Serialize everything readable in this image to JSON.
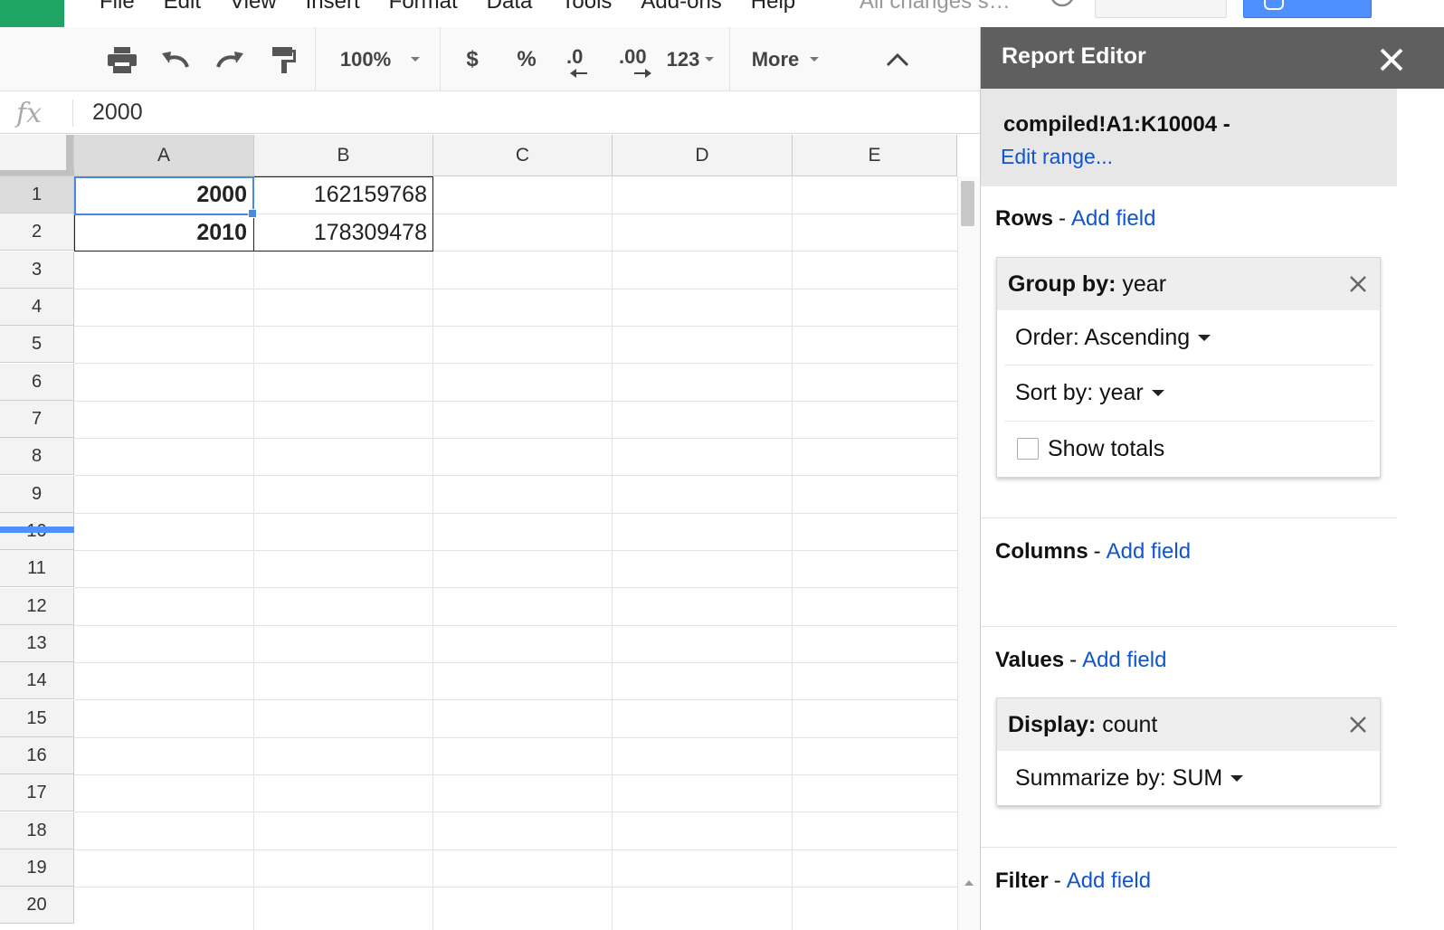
{
  "menu": {
    "items": [
      "File",
      "Edit",
      "View",
      "Insert",
      "Format",
      "Data",
      "Tools",
      "Add-ons",
      "Help"
    ],
    "save_status": "All changes s…"
  },
  "toolbar": {
    "zoom": "100%",
    "currency": "$",
    "percent": "%",
    "decrease_decimal": ".0",
    "increase_decimal": ".00",
    "number_format": "123",
    "more": "More"
  },
  "formula_bar": {
    "fx_label": "fx",
    "value": "2000"
  },
  "grid": {
    "columns": [
      "A",
      "B",
      "C",
      "D",
      "E"
    ],
    "rows": [
      "1",
      "2",
      "3",
      "4",
      "5",
      "6",
      "7",
      "8",
      "9",
      "10",
      "11",
      "12",
      "13",
      "14",
      "15",
      "16",
      "17",
      "18",
      "19",
      "20"
    ],
    "cells": {
      "A1": "2000",
      "B1": "162159768",
      "A2": "2010",
      "B2": "178309478"
    },
    "selected_cell": "A1"
  },
  "report_editor": {
    "title": "Report Editor",
    "range": "compiled!A1:K10004 -",
    "edit_range": "Edit range...",
    "rows": {
      "label": "Rows",
      "dash": "-",
      "add_field": "Add field",
      "card": {
        "head_key": "Group by:",
        "head_value": "year",
        "order": "Order: Ascending",
        "sort": "Sort by: year",
        "show_totals": "Show totals",
        "show_totals_checked": false
      }
    },
    "columns": {
      "label": "Columns",
      "dash": "-",
      "add_field": "Add field"
    },
    "values": {
      "label": "Values",
      "dash": "-",
      "add_field": "Add field",
      "card": {
        "head_key": "Display:",
        "head_value": "count",
        "summarize": "Summarize by: SUM"
      }
    },
    "filter": {
      "label": "Filter",
      "dash": "-",
      "add_field": "Add field"
    }
  },
  "colors": {
    "accent_blue": "#4a89dc",
    "link_blue": "#1155cc",
    "panel_header": "#5f5f5f",
    "sheets_green": "#1fa463",
    "share_blue": "#4d90fe"
  }
}
